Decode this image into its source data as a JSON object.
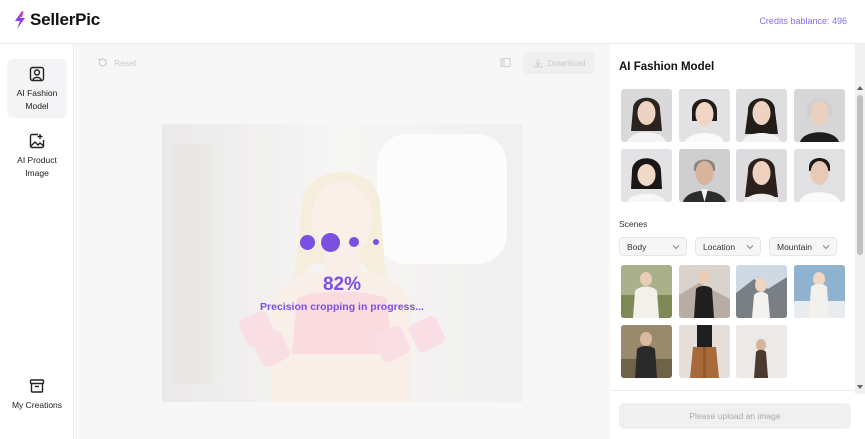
{
  "header": {
    "logo_text": "SellerPic",
    "credits_label": "Credits bablance: 496",
    "brand_color": "#7b4fe0"
  },
  "nav": {
    "items": [
      {
        "label": "AI Fashion Model",
        "icon": "portrait-icon",
        "active": true
      },
      {
        "label": "AI Product Image",
        "icon": "image-edit-icon",
        "active": false
      },
      {
        "label": "My Creations",
        "icon": "archive-box-icon",
        "active": false
      }
    ]
  },
  "toolbar": {
    "reset_label": "Reset",
    "download_label": "Download"
  },
  "canvas": {
    "progress_label": "82%",
    "progress_value": 0.82,
    "status_text": "Precision cropping in progress..."
  },
  "panel": {
    "title": "AI Fashion Model",
    "models_count": 8,
    "scenes_label": "Scenes",
    "filters": [
      {
        "label": "Body",
        "icon": "chevron-down-icon"
      },
      {
        "label": "Location",
        "icon": "chevron-down-icon"
      },
      {
        "label": "Mountain",
        "icon": "chevron-down-icon"
      }
    ],
    "scenes_count": 7
  },
  "footer": {
    "upload_button_label": "Please upload an image"
  }
}
